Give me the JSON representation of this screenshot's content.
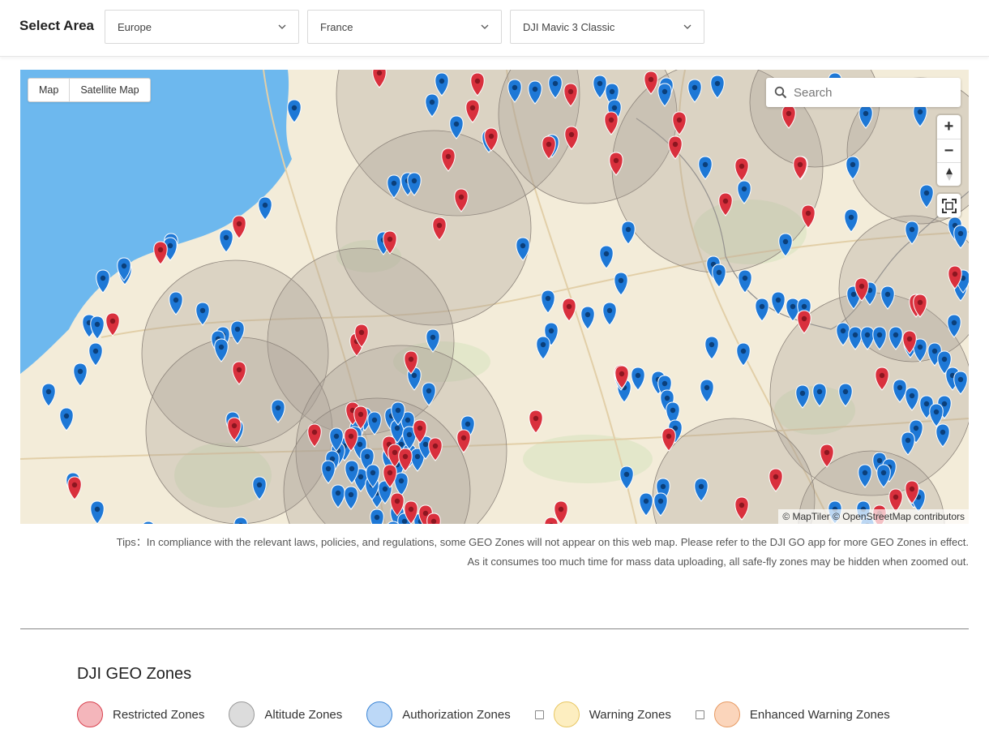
{
  "header": {
    "title": "Select Area",
    "region": "Europe",
    "country": "France",
    "drone": "DJI Mavic 3 Classic"
  },
  "map": {
    "map_type_options": [
      "Map",
      "Satellite Map"
    ],
    "search_placeholder": "Search",
    "zoom_in_label": "+",
    "zoom_out_label": "−",
    "attribution": "© MapTiler © OpenStreetMap contributors"
  },
  "tips": {
    "line1": "Tips：In compliance with the relevant laws, policies, and regulations, some GEO Zones will not appear on this web map. Please refer to the DJI GO app for more GEO Zones in effect.",
    "line2": "As it consumes too much time for mass data uploading, all safe-fly zones may be hidden when zoomed out."
  },
  "legend": {
    "title": "DJI GEO Zones",
    "items": [
      {
        "label": "Restricted Zones",
        "color": "#f4b6bb",
        "border": "#d9424f",
        "has_checkbox": false
      },
      {
        "label": "Altitude Zones",
        "color": "#dcdcdc",
        "border": "#9a9a9a",
        "has_checkbox": false
      },
      {
        "label": "Authorization Zones",
        "color": "#bcd8f7",
        "border": "#3d86d6",
        "has_checkbox": false
      },
      {
        "label": "Warning Zones",
        "color": "#fdeec0",
        "border": "#e8c763",
        "has_checkbox": true
      },
      {
        "label": "Enhanced Warning Zones",
        "color": "#fbd5bb",
        "border": "#e79a63",
        "has_checkbox": true
      }
    ]
  },
  "colors": {
    "sea": "#6db8ee",
    "land": "#f3ecd9",
    "restricted_pin": "#d9303d",
    "authorization_pin": "#1e78d6",
    "altitude_zone": "#a89e94"
  }
}
